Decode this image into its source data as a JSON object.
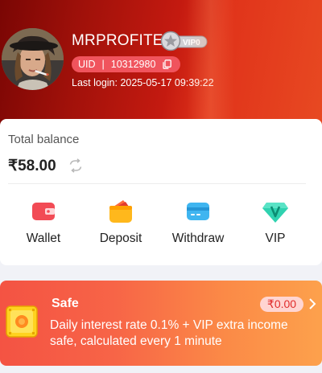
{
  "profile": {
    "username": "MRPROFITE",
    "vip_level": "VIP0",
    "uid_label": "UID",
    "uid_value": "10312980",
    "last_login": "Last login: 2025-05-17 09:39:22"
  },
  "balance": {
    "label": "Total balance",
    "amount": "₹58.00"
  },
  "actions": [
    {
      "label": "Wallet",
      "icon": "wallet-icon"
    },
    {
      "label": "Deposit",
      "icon": "deposit-icon"
    },
    {
      "label": "Withdraw",
      "icon": "withdraw-icon"
    },
    {
      "label": "VIP",
      "icon": "vip-icon"
    }
  ],
  "safe": {
    "title": "Safe",
    "amount": "₹0.00",
    "description": "Daily interest rate 0.1% + VIP extra income safe, calculated every 1 minute"
  },
  "colors": {
    "header_dark": "#7a0604",
    "header_light": "#e84a22",
    "uid_pill": "#f0545d",
    "safe_start": "#f45343",
    "safe_end": "#fda14c",
    "safe_amount_text": "#e02c2c"
  }
}
